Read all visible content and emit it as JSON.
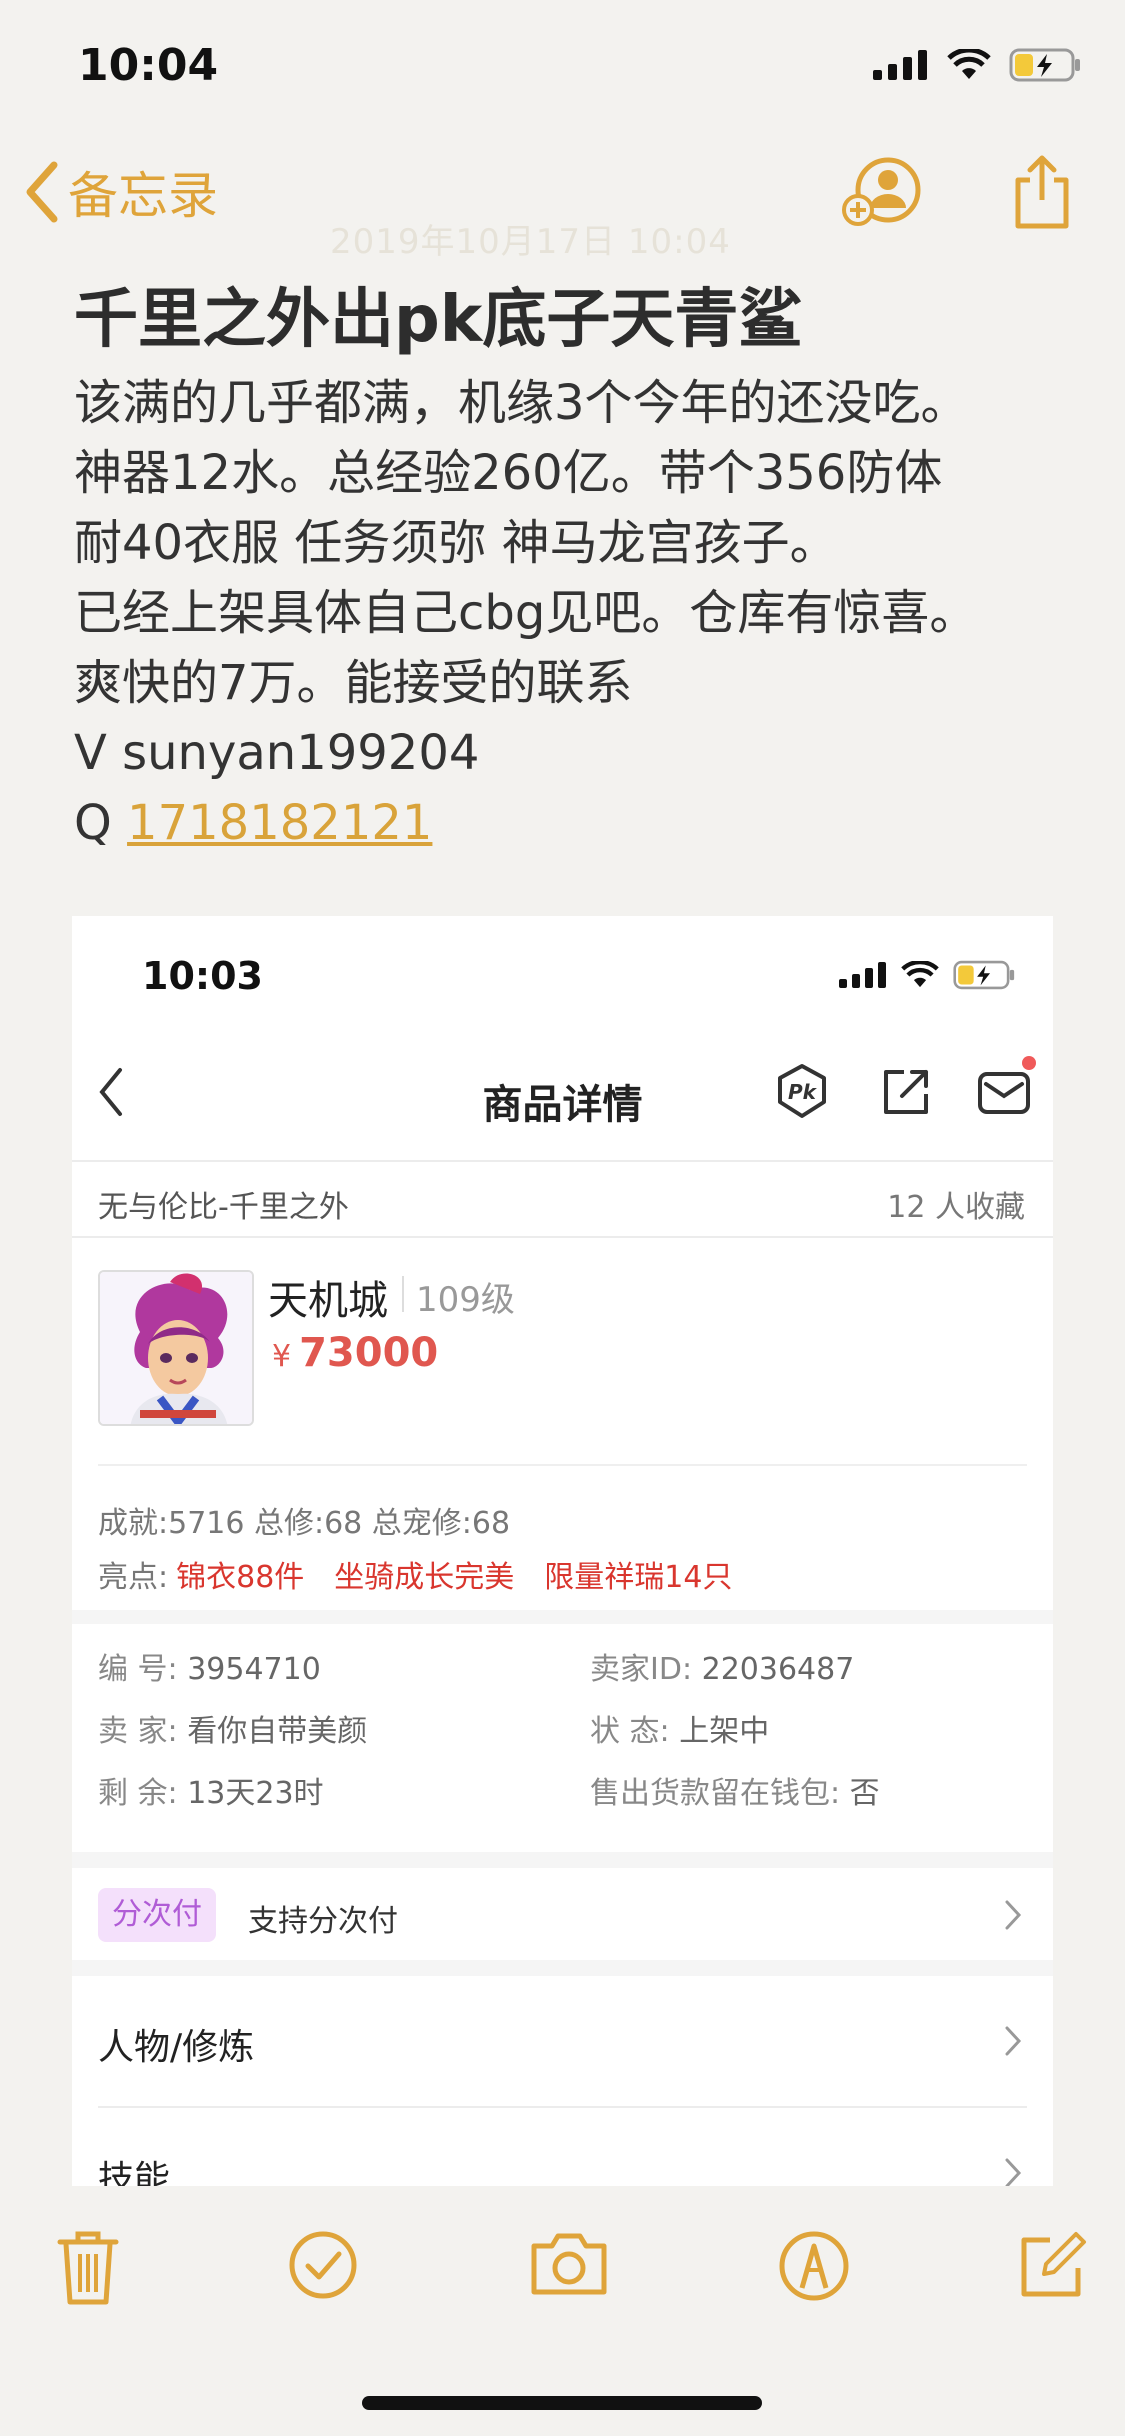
{
  "status_bar": {
    "time": "10:04"
  },
  "nav": {
    "back_label": "备忘录",
    "date_faint": "2019年10月17日 10:04"
  },
  "note": {
    "title": "千里之外出pk底子天青鲨",
    "lines": [
      "该满的几乎都满，机缘3个今年的还没吃。",
      "神器12水。总经验260亿。带个356防体",
      "耐40衣服 任务须弥 神马龙宫孩子。",
      "已经上架具体自己cbg见吧。仓库有惊喜。",
      "爽快的7万。能接受的联系",
      "V sunyan199204"
    ],
    "q_prefix": "Q ",
    "q_number": "1718182121"
  },
  "embedded": {
    "status_time": "10:03",
    "header_title": "商品详情",
    "server": "无与伦比-千里之外",
    "fav_count": "12 人收藏",
    "role_name": "天机城",
    "role_level": "109级",
    "price_symbol": "¥",
    "price": "73000",
    "stats": "成就:5716 总修:68 总宠修:68",
    "highlights_label": "亮点:",
    "highlights": [
      "锦衣88件",
      "坐骑成长完美",
      "限量祥瑞14只"
    ],
    "info": {
      "id_key": "编 号:",
      "id_val": "3954710",
      "seller_id_key": "卖家ID:",
      "seller_id_val": "22036487",
      "seller_key": "卖 家:",
      "seller_val": "看你自带美颜",
      "status_key": "状 态:",
      "status_val": "上架中",
      "remain_key": "剩 余:",
      "remain_val": "13天23时",
      "wallet_key": "售出货款留在钱包:",
      "wallet_val": "否"
    },
    "pay_tag": "分次付",
    "pay_text": "支持分次付",
    "menu": [
      "人物/修炼",
      "技能"
    ]
  },
  "colors": {
    "accent": "#dfa43a",
    "price": "#e0574f",
    "highlight": "#d9362e",
    "pay_tag": "#b05cd6"
  }
}
